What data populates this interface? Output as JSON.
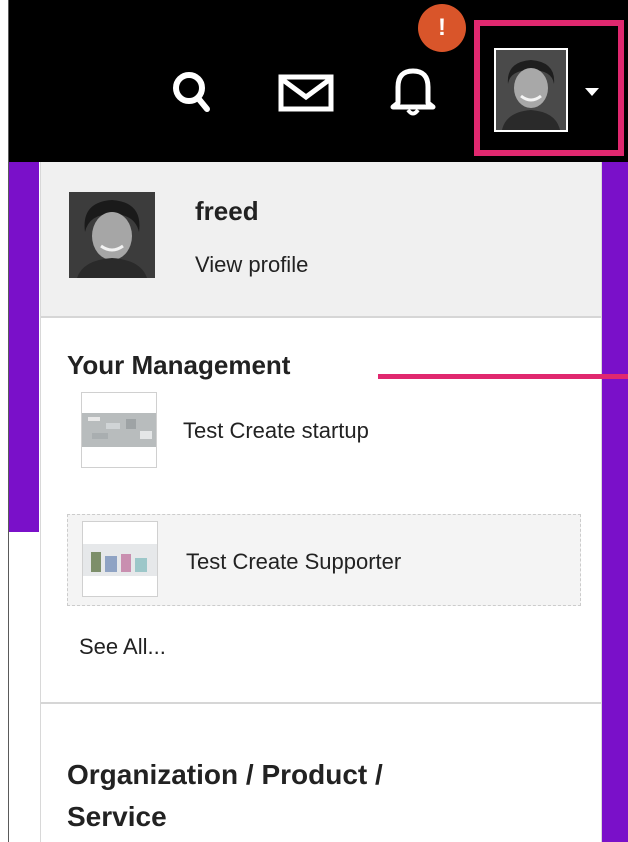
{
  "header": {
    "icons": {
      "search": "search-icon",
      "mail": "mail-icon",
      "bell": "bell-icon",
      "caret": "caret-down-icon"
    },
    "notification_count": "!",
    "colors": {
      "topbar": "#000000",
      "accent_purple": "#7a10c9",
      "highlight": "#e0286f",
      "badge": "#d9552a"
    }
  },
  "profile": {
    "username": "freed",
    "view_profile_label": "View profile"
  },
  "management": {
    "title": "Your Management",
    "items": [
      {
        "label": "Test Create startup"
      },
      {
        "label": "Test Create Supporter"
      }
    ],
    "see_all_label": "See All..."
  },
  "organization": {
    "title": "Organization / Product / Service"
  }
}
